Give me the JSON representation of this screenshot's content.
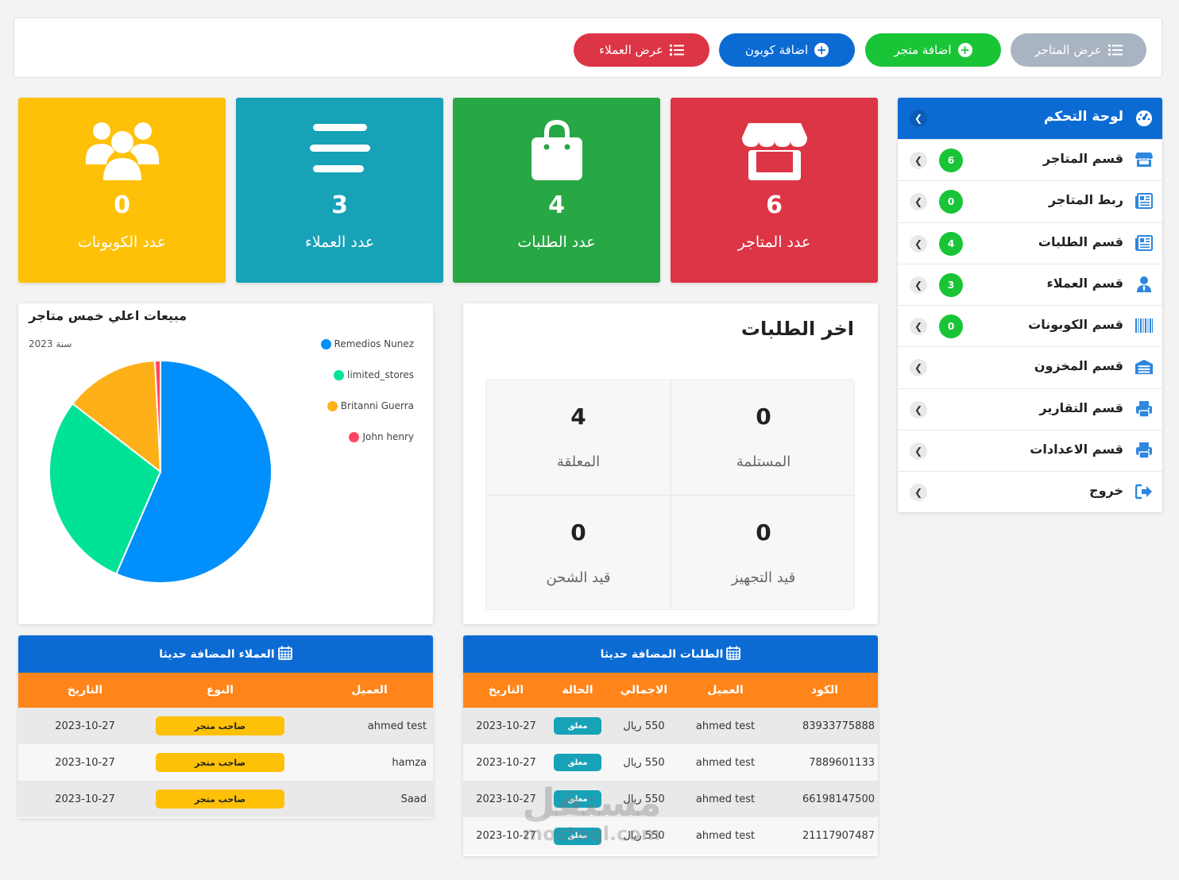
{
  "topbar": {
    "buttons": [
      {
        "label": "عرض المتاجر",
        "icon": "list-icon",
        "color": "#a9b4c2"
      },
      {
        "label": "اضافة متجر",
        "icon": "plus-circle-icon",
        "color": "#19c437"
      },
      {
        "label": "اضافة كوبون",
        "icon": "plus-circle-icon",
        "color": "#0b6bd3"
      },
      {
        "label": "عرض العملاء",
        "icon": "list-icon",
        "color": "#dc3545"
      }
    ]
  },
  "stats": [
    {
      "label": "عدد المتاجر",
      "value": "6",
      "icon": "store-icon",
      "color": "#dc3545"
    },
    {
      "label": "عدد الطلبات",
      "value": "4",
      "icon": "shopping-bag-icon",
      "color": "#28a745"
    },
    {
      "label": "عدد العملاء",
      "value": "3",
      "icon": "bars-icon",
      "color": "#17a2b8"
    },
    {
      "label": "عدد الكوبونات",
      "value": "0",
      "icon": "users-icon",
      "color": "#ffc107"
    }
  ],
  "sidebar": {
    "title": "لوحة التحكم",
    "title_icon": "dashboard-icon",
    "items": [
      {
        "label": "قسم المتاجر",
        "icon": "store-icon",
        "badge": "6"
      },
      {
        "label": "ربط المتاجر",
        "icon": "newspaper-icon",
        "badge": "0"
      },
      {
        "label": "قسم الطلبات",
        "icon": "newspaper-icon",
        "badge": "4"
      },
      {
        "label": "قسم العملاء",
        "icon": "user-icon",
        "badge": "3"
      },
      {
        "label": "قسم الكوبونات",
        "icon": "barcode-icon",
        "badge": "0"
      },
      {
        "label": "قسم المخزون",
        "icon": "warehouse-icon",
        "badge": null
      },
      {
        "label": "قسم التقارير",
        "icon": "printer-icon",
        "badge": null
      },
      {
        "label": "قسم الاعدادات",
        "icon": "printer-icon",
        "badge": null
      },
      {
        "label": "خروج",
        "icon": "sign-out-icon",
        "badge": null
      }
    ]
  },
  "sales_chart": {
    "title": "مبيعات اعلي خمس متاجر",
    "subtitle": "سنة 2023"
  },
  "chart_data": {
    "type": "pie",
    "title": "مبيعات اعلي خمس متاجر",
    "subtitle": "سنة 2023",
    "legend_position": "top-right",
    "labels": [
      "Remedios Nunez",
      "limited_stores",
      "Britanni Guerra",
      "John henry"
    ],
    "values": [
      56.5,
      29.0,
      13.7,
      0.8
    ],
    "colors": [
      "#008ffb",
      "#00e396",
      "#feb019",
      "#ff4560"
    ]
  },
  "latest_orders": {
    "title": "اخر الطلبات",
    "cells": [
      {
        "label": "المستلمة",
        "value": "0"
      },
      {
        "label": "المعلقة",
        "value": "4"
      },
      {
        "label": "قيد التجهيز",
        "value": "0"
      },
      {
        "label": "قيد الشحن",
        "value": "0"
      }
    ]
  },
  "customers_table": {
    "title": "العملاء المضافة حديثا",
    "columns": [
      "العميل",
      "النوع",
      "التاريخ"
    ],
    "rows": [
      {
        "name": "ahmed test",
        "type": "صاحب متجر",
        "date": "2023-10-27"
      },
      {
        "name": "hamza",
        "type": "صاحب متجر",
        "date": "2023-10-27"
      },
      {
        "name": "Saad",
        "type": "صاحب متجر",
        "date": "2023-10-27"
      }
    ]
  },
  "orders_table": {
    "title": "الطلبات المضافة حديثا",
    "columns": [
      "الكود",
      "العميل",
      "الاجمالي",
      "الحالة",
      "التاريخ"
    ],
    "rows": [
      {
        "code": "83933775888",
        "customer": "ahmed test",
        "total": "550 ريال",
        "status": "معلق",
        "date": "2023-10-27"
      },
      {
        "code": "7889601133",
        "customer": "ahmed test",
        "total": "550 ريال",
        "status": "معلق",
        "date": "2023-10-27"
      },
      {
        "code": "66198147500",
        "customer": "ahmed test",
        "total": "550 ريال",
        "status": "معلق",
        "date": "2023-10-27"
      },
      {
        "code": "21117907487",
        "customer": "ahmed test",
        "total": "550 ريال",
        "status": "معلق",
        "date": "2023-10-27"
      }
    ]
  },
  "watermark": {
    "line1": "مستقل",
    "line2": "mostaql.com"
  }
}
